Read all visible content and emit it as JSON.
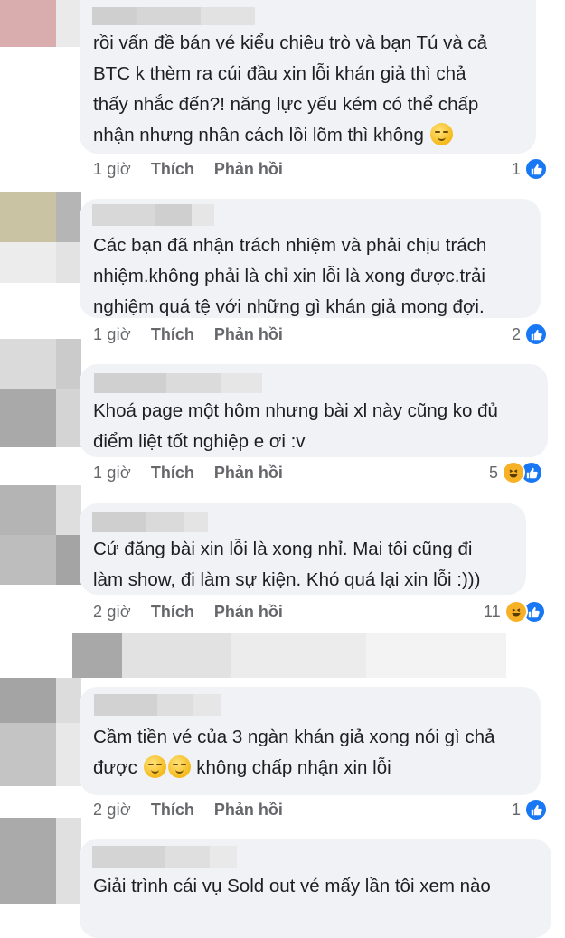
{
  "comments": [
    {
      "text_lines": [
        "rồi vấn đề bán vé kiểu chiêu trò và bạn Tú và cả",
        "BTC k thèm ra cúi đầu xin lỗi khán giả thì chả",
        "thấy nhắc đến?! năng lực yếu kém có thể chấp",
        "nhận nhưng nhân cách lồi lõm thì không"
      ],
      "time": "1 giờ",
      "like_label": "Thích",
      "reply_label": "Phản hồi",
      "reaction_count": "1",
      "reactions": [
        "like-icon"
      ]
    },
    {
      "text_lines": [
        "Các bạn đã nhận trách nhiệm và phải chịu trách",
        "nhiệm.không phải là chỉ xin lỗi là xong được.trải",
        "nghiệm quá tệ với những gì khán giả mong đợi."
      ],
      "time": "1 giờ",
      "like_label": "Thích",
      "reply_label": "Phản hồi",
      "reaction_count": "2",
      "reactions": [
        "like-icon"
      ]
    },
    {
      "text_lines": [
        "Khoá page một hôm nhưng bài xl này cũng ko đủ",
        "điểm liệt tốt nghiệp e ơi :v"
      ],
      "time": "1 giờ",
      "like_label": "Thích",
      "reply_label": "Phản hồi",
      "reaction_count": "5",
      "reactions": [
        "haha-icon",
        "like-icon"
      ]
    },
    {
      "text_lines": [
        "Cứ đăng bài xin lỗi là xong nhỉ. Mai tôi cũng đi",
        "làm show, đi làm sự kiện. Khó quá lại xin lỗi :)))"
      ],
      "time": "2 giờ",
      "like_label": "Thích",
      "reply_label": "Phản hồi",
      "reaction_count": "11",
      "reactions": [
        "haha-icon",
        "like-icon"
      ]
    },
    {
      "text_lines": [
        "Cầm tiền vé của 3 ngàn khán giả xong nói gì chả",
        "được",
        "không chấp nhận xin lỗi"
      ],
      "time": "2 giờ",
      "like_label": "Thích",
      "reply_label": "Phản hồi",
      "reaction_count": "1",
      "reactions": [
        "like-icon"
      ]
    },
    {
      "text_lines": [
        "Giải trình cái vụ Sold out vé mấy lần tôi xem nào"
      ]
    }
  ],
  "colors": {
    "bubble": "#f0f2f5",
    "meta_text": "#65676b",
    "like_blue": "#1877f2",
    "haha_yellow": "#f7b125"
  }
}
